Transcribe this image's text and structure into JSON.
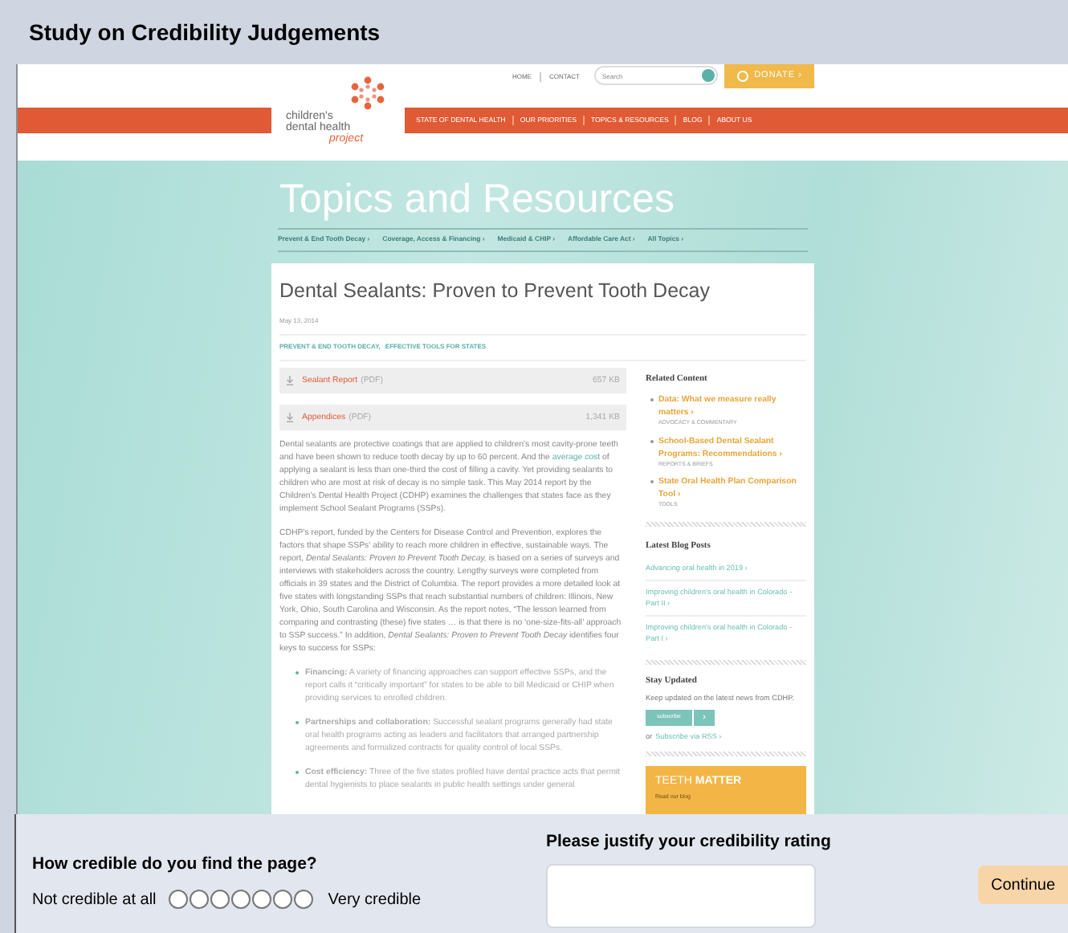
{
  "window": {
    "title": "Study on Credibility Judgements"
  },
  "site": {
    "utility_links": [
      "HOME",
      "CONTACT"
    ],
    "search": {
      "placeholder": "Search"
    },
    "donate": "DONATE ›",
    "logo": [
      "children's",
      "dental health",
      "project"
    ],
    "nav": [
      "STATE OF DENTAL HEALTH",
      "OUR PRIORITIES",
      "TOPICS & RESOURCES",
      "BLOG",
      "ABOUT US"
    ],
    "heading": "Topics and Resources",
    "topics": [
      "Prevent & End Tooth Decay ›",
      "Coverage, Access & Financing ›",
      "Medicaid & CHIP ›",
      "Affordable Care Act ›",
      "All Topics ›"
    ]
  },
  "article": {
    "title": "Dental Sealants: Proven to Prevent Tooth Decay",
    "date": "May 13, 2014",
    "tags": [
      "PREVENT & END TOOTH DECAY,",
      "EFFECTIVE TOOLS FOR STATES"
    ],
    "downloads": [
      {
        "name": "Sealant Report",
        "type": "(PDF)",
        "size": "657 KB"
      },
      {
        "name": "Appendices",
        "type": "(PDF)",
        "size": "1,341 KB"
      }
    ],
    "intro": {
      "before": "Dental sealants are protective coatings that are applied to children's most cavity-prone teeth and have been shown to reduce tooth decay by up to 60 percent. And the",
      "link": "average cost",
      "after": "of applying a sealant is less than one-third the cost of filling a cavity. Yet providing sealants to children who are most at risk of decay is no simple task. This May 2014 report by the Children's Dental Health Project (CDHP) examines the challenges that states face as they implement School Sealant Programs (SSPs)."
    },
    "body": "CDHP's report, funded by the Centers for Disease Control and Prevention, explores the factors that shape SSPs' ability to reach more children in effective, sustainable ways. The report, *Dental Sealants: Proven to Prevent Tooth Decay,* is based on a series of surveys and interviews with stakeholders across the country. Lengthy surveys were completed from officials in 39 states and the District of Columbia. The report provides a more detailed look at five states with longstanding SSPs that reach substantial numbers of children: Illinois, New York, Ohio, South Carolina and Wisconsin. As the report notes, “The lesson learned from comparing and contrasting (these) five states … is that there is no ‘one-size-fits-all’ approach to SSP success.” In addition, *Dental Sealants: Proven to Prevent Tooth Decay* identifies four keys to success for SSPs:",
    "keys": [
      "**Financing:** A variety of financing approaches can support effective SSPs, and the report calls it “critically important” for states to be able to bill Medicaid or CHIP when providing services to enrolled children.",
      "**Partnerships and collaboration:** Successful sealant programs generally had state oral health programs acting as leaders and facilitators that arranged partnership agreements and formalized contracts for quality control of local SSPs.",
      "**Cost efficiency:** Three of the five states profiled have dental practice acts that permit dental hygienists to place sealants in public health settings under general"
    ]
  },
  "sidebar": {
    "related_title": "Related Content",
    "related": [
      {
        "title": "Data: What we measure really matters ›",
        "category": "ADVOCACY & COMMENTARY"
      },
      {
        "title": "School-Based Dental Sealant Programs: Recommendations ›",
        "category": "REPORTS & BRIEFS"
      },
      {
        "title": "State Oral Health Plan Comparison Tool ›",
        "category": "TOOLS"
      }
    ],
    "blog_title": "Latest Blog Posts",
    "blog": [
      "Advancing oral health in 2019 ›",
      "Improving children's oral health in Colorado - Part II ›",
      "Improving children's oral health in Colorado - Part I ›"
    ],
    "updates_title": "Stay Updated",
    "updates_text": "Keep updated on the latest news from CDHP.",
    "subscribe": "subscribe",
    "subscribe_arrow": "›",
    "or": "or",
    "rss": "Subscribe via RSS ›",
    "promo": {
      "light": "TEETH",
      "bold": "MATTER",
      "sub": "Read our blog"
    }
  },
  "survey": {
    "question": "How credible do you find the page?",
    "low": "Not credible at all",
    "high": "Very credible",
    "scale": [
      {
        "selected": false
      },
      {
        "selected": false
      },
      {
        "selected": false
      },
      {
        "selected": false
      },
      {
        "selected": false
      },
      {
        "selected": false
      },
      {
        "selected": false
      }
    ],
    "justify_label": "Please justify your credibility rating",
    "continue": "Continue"
  }
}
